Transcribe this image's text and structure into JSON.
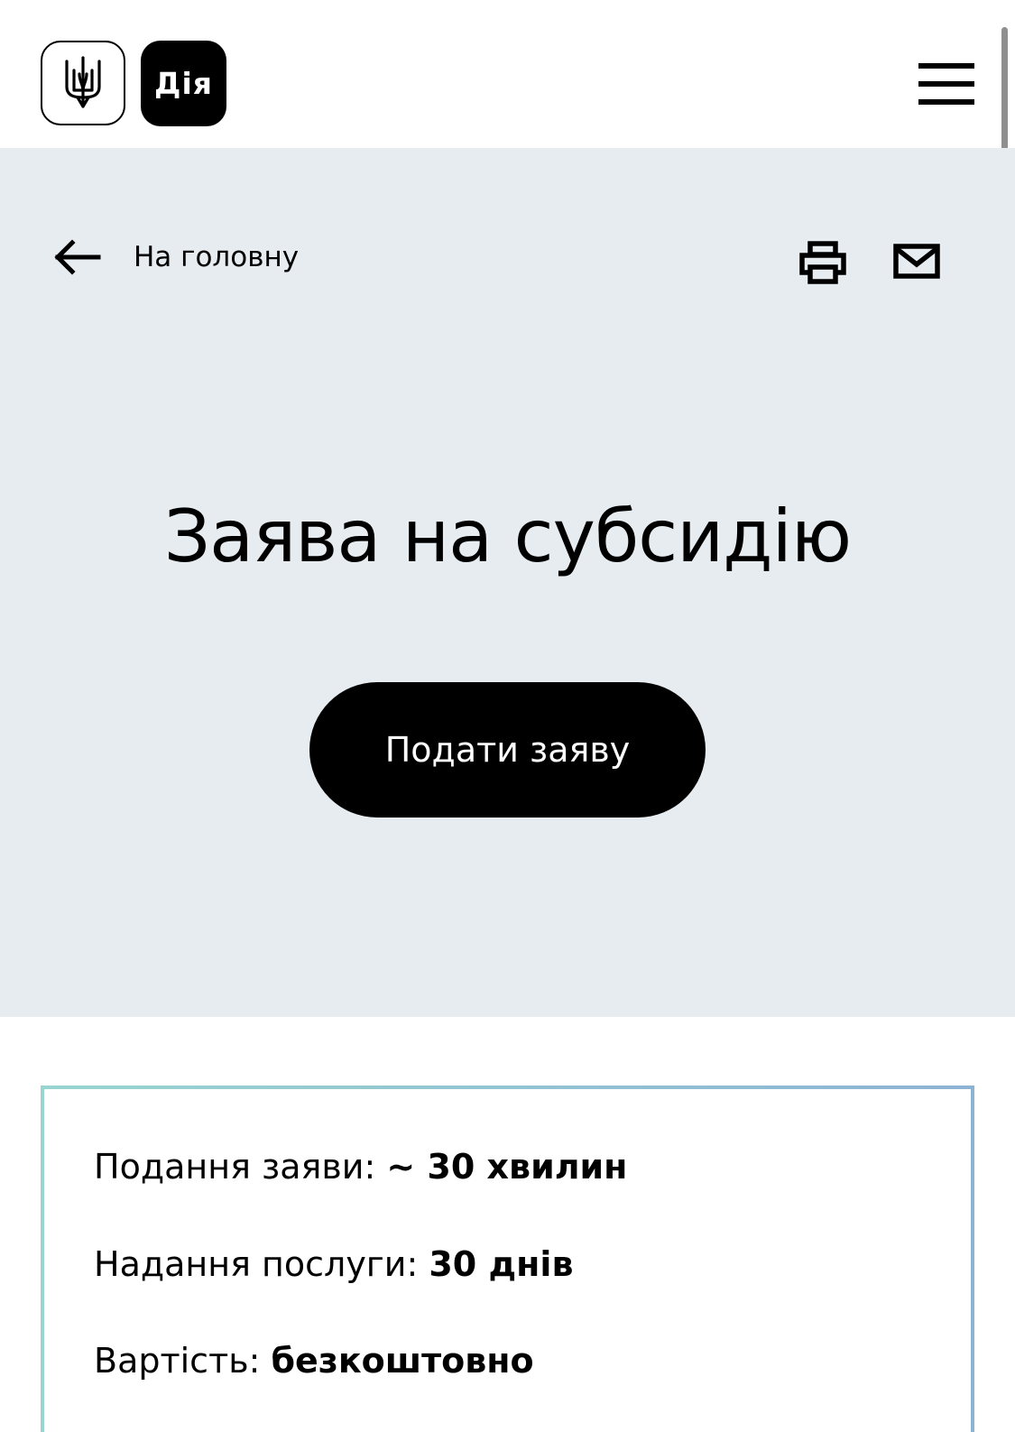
{
  "header": {
    "emblem_icon": "trident-icon",
    "app_logo_text": "Дія",
    "menu_icon": "hamburger-menu-icon"
  },
  "hero": {
    "back_icon": "arrow-left-icon",
    "back_label": "На головну",
    "print_icon": "printer-icon",
    "email_icon": "envelope-icon",
    "title": "Заява на субсидію",
    "apply_label": "Подати заяву"
  },
  "info": {
    "rows": [
      {
        "label": "Подання заяви: ",
        "value": "~ 30 хвилин"
      },
      {
        "label": "Надання послуги: ",
        "value": "30 днів"
      },
      {
        "label": "Вартість: ",
        "value": "безкоштовно"
      }
    ]
  },
  "colors": {
    "hero_background": "#e7ecf0",
    "button_background": "#000000",
    "button_text": "#ffffff",
    "card_border_start": "#97d5d1",
    "card_border_end": "#8db3d4"
  }
}
